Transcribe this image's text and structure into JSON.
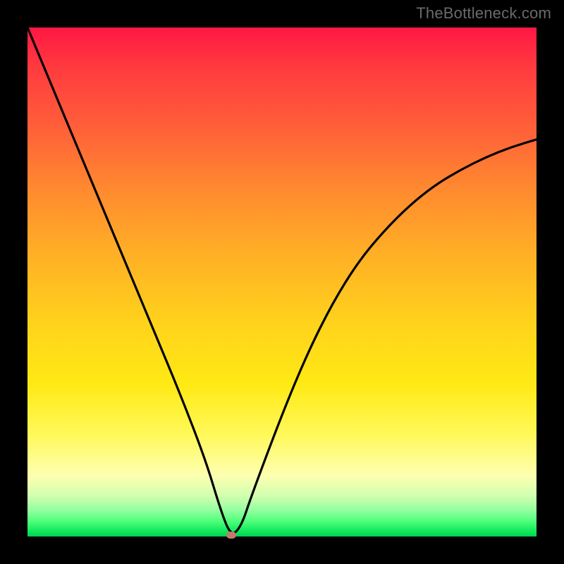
{
  "watermark": "TheBottleneck.com",
  "colors": {
    "frame": "#000000",
    "curve": "#000000",
    "marker": "#c17a6b",
    "gradient_top": "#ff1744",
    "gradient_bottom": "#00d154"
  },
  "chart_data": {
    "type": "line",
    "title": "",
    "xlabel": "",
    "ylabel": "",
    "xlim": [
      0,
      100
    ],
    "ylim": [
      0,
      100
    ],
    "grid": false,
    "legend": false,
    "series": [
      {
        "name": "bottleneck-curve",
        "x": [
          0,
          5,
          10,
          15,
          20,
          25,
          30,
          35,
          38,
          40,
          42,
          44,
          50,
          55,
          60,
          65,
          70,
          75,
          80,
          85,
          90,
          95,
          100
        ],
        "y": [
          100,
          88,
          76,
          64,
          52,
          40,
          28,
          15,
          5,
          0,
          2,
          8,
          24,
          36,
          46,
          54,
          60,
          65,
          69,
          72,
          74.5,
          76.5,
          78
        ]
      }
    ],
    "annotations": [
      {
        "name": "optimal-point",
        "x": 40,
        "y": 0
      }
    ]
  }
}
